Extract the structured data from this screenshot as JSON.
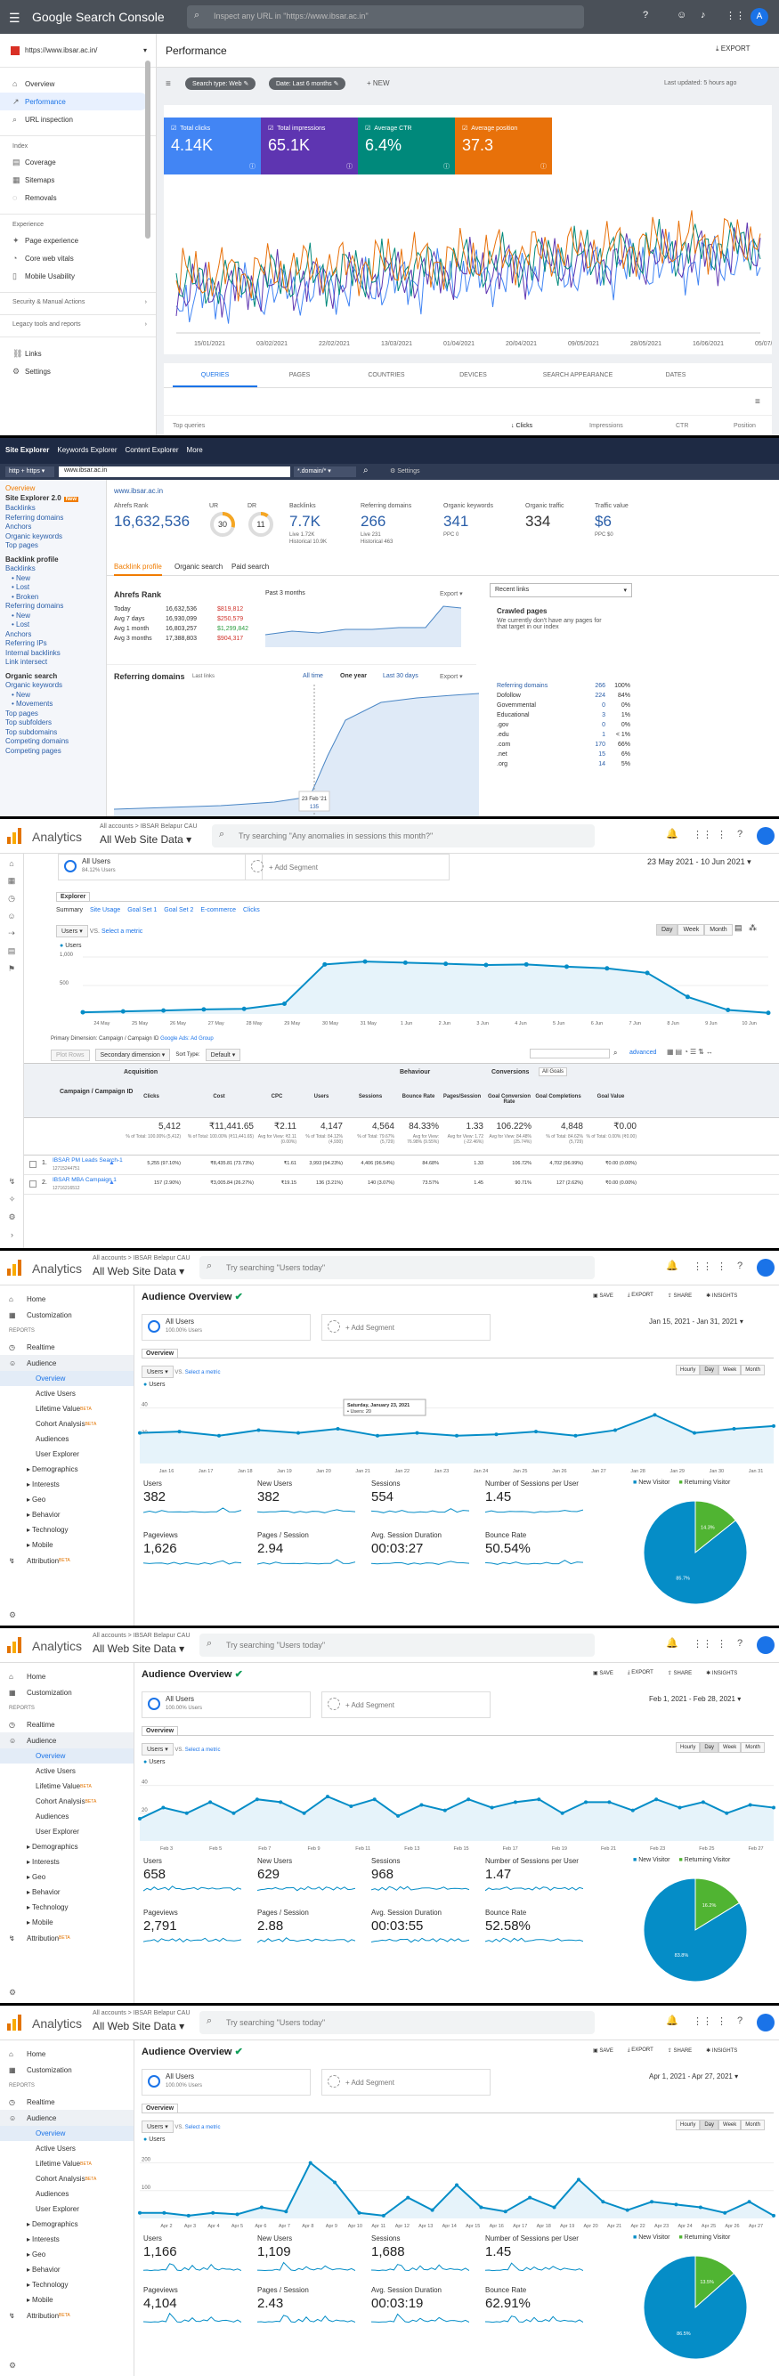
{
  "gsc": {
    "app_title": "Google Search Console",
    "search_placeholder": "Inspect any URL in \"https://www.ibsar.ac.in\"",
    "property": "https://www.ibsar.ac.in/",
    "page_title": "Performance",
    "export_label": "EXPORT",
    "last_updated": "Last updated: 5 hours ago",
    "filter_search_type": "Search type: Web",
    "filter_date": "Date: Last 6 months",
    "new_label": "NEW",
    "nav": [
      {
        "label": "Overview",
        "icon": "home-icon"
      },
      {
        "label": "Performance",
        "icon": "trend-icon",
        "active": true
      },
      {
        "label": "URL inspection",
        "icon": "search-icon"
      }
    ],
    "nav_index_title": "Index",
    "nav_index": [
      "Coverage",
      "Sitemaps",
      "Removals"
    ],
    "nav_experience_title": "Experience",
    "nav_experience": [
      "Page experience",
      "Core web vitals",
      "Mobile Usability"
    ],
    "nav_security": "Security & Manual Actions",
    "nav_legacy": "Legacy tools and reports",
    "nav_links": "Links",
    "nav_settings": "Settings",
    "cards": [
      {
        "label": "Total clicks",
        "value": "4.14K",
        "color": "#4285f4"
      },
      {
        "label": "Total impressions",
        "value": "65.1K",
        "color": "#5e35b1"
      },
      {
        "label": "Average CTR",
        "value": "6.4%",
        "color": "#00897b"
      },
      {
        "label": "Average position",
        "value": "37.3",
        "color": "#e8710a"
      }
    ],
    "x_labels": [
      "15/01/2021",
      "03/02/2021",
      "22/02/2021",
      "13/03/2021",
      "01/04/2021",
      "20/04/2021",
      "09/05/2021",
      "28/05/2021",
      "16/06/2021",
      "05/07/2021"
    ],
    "tabs": [
      "QUERIES",
      "PAGES",
      "COUNTRIES",
      "DEVICES",
      "SEARCH APPEARANCE",
      "DATES"
    ],
    "table_headers": [
      "Top queries",
      "Clicks",
      "Impressions",
      "CTR",
      "Position"
    ]
  },
  "ahrefs": {
    "nav": [
      "Site Explorer",
      "Keywords Explorer",
      "Content Explorer",
      "More"
    ],
    "protocol": "http + https",
    "url": "www.ibsar.ac.in",
    "mode": "*.domain/*",
    "settings": "Settings",
    "sidebar": [
      {
        "t": "Overview",
        "c": "o"
      },
      {
        "t": "Site Explorer 2.0",
        "c": "b",
        "badge": "New"
      },
      {
        "t": "Backlinks"
      },
      {
        "t": "Referring domains"
      },
      {
        "t": "Anchors"
      },
      {
        "t": "Organic keywords"
      },
      {
        "t": "Top pages"
      },
      {
        "t": "Backlink profile",
        "c": "b"
      },
      {
        "t": "Backlinks"
      },
      {
        "t": "New",
        "c": "s"
      },
      {
        "t": "Lost",
        "c": "s"
      },
      {
        "t": "Broken",
        "c": "s"
      },
      {
        "t": "Referring domains"
      },
      {
        "t": "New",
        "c": "s"
      },
      {
        "t": "Lost",
        "c": "s"
      },
      {
        "t": "Anchors"
      },
      {
        "t": "Referring IPs"
      },
      {
        "t": "Internal backlinks"
      },
      {
        "t": "Link intersect"
      },
      {
        "t": "Organic search",
        "c": "b"
      },
      {
        "t": "Organic keywords"
      },
      {
        "t": "New",
        "c": "s"
      },
      {
        "t": "Movements",
        "c": "s"
      },
      {
        "t": "Top pages"
      },
      {
        "t": "Top subfolders"
      },
      {
        "t": "Top subdomains"
      },
      {
        "t": "Competing domains"
      },
      {
        "t": "Competing pages"
      }
    ],
    "site": "www.ibsar.ac.in",
    "ar_label": "Ahrefs Rank",
    "ar_value": "16,632,536",
    "ur_label": "UR",
    "ur_value": "30",
    "dr_label": "DR",
    "dr_value": "11",
    "bl_label": "Backlinks",
    "bl_value": "7.7K",
    "bl_sub1": "Live 1.72K",
    "bl_sub2": "Historical 10.9K",
    "rd_label": "Referring domains",
    "rd_value": "266",
    "rd_sub1": "Live 231",
    "rd_sub2": "Historical 463",
    "ok_label": "Organic keywords",
    "ok_value": "341",
    "ok_sub": "PPC 0",
    "ot_label": "Organic traffic",
    "ot_value": "334",
    "tv_label": "Traffic value",
    "tv_value": "$6",
    "tv_sub": "PPC $0",
    "tabs": [
      "Backlink profile",
      "Organic search",
      "Paid search"
    ],
    "rank_title": "Ahrefs Rank",
    "rank_rows": [
      [
        "Today",
        "16,632,536",
        "$819,812"
      ],
      [
        "Avg 7 days",
        "16,930,099",
        "$250,579"
      ],
      [
        "Avg 1 month",
        "16,803,257",
        "$1,299,842"
      ],
      [
        "Avg 3 months",
        "17,388,803",
        "$904,317"
      ]
    ],
    "past": "Past 3 months",
    "export": "Export",
    "rd_title": "Referring domains",
    "used_links": "Last links",
    "all_time": "All time",
    "one_year": "One year",
    "last30": "Last 30 days",
    "tooltip_date": "23 Feb '21",
    "tooltip_val": "135",
    "recent_links": "Recent links",
    "crawled_title": "Crawled pages",
    "crawled_text": "We currently don't have any pages for that target in our index",
    "rd_table": [
      [
        "Referring domains",
        "266",
        "100%"
      ],
      [
        "Dofollow",
        "224",
        "84%"
      ],
      [
        "Governmental",
        "0",
        "0%"
      ],
      [
        "Educational",
        "3",
        "1%"
      ],
      [
        ".gov",
        "0",
        "0%"
      ],
      [
        ".edu",
        "1",
        "< 1%"
      ],
      [
        ".com",
        "170",
        "66%"
      ],
      [
        ".net",
        "15",
        "6%"
      ],
      [
        ".org",
        "14",
        "5%"
      ]
    ]
  },
  "ga1": {
    "brand": "Analytics",
    "account": "All accounts > IBSAR Belapur CAU",
    "view": "All Web Site Data",
    "search": "Try searching \"Any anomalies in sessions this month?\"",
    "segment": "All Users",
    "segment_pct": "84.12% Users",
    "add_segment": "+ Add Segment",
    "date": "23 May 2021 - 10 Jun 2021",
    "explorer": "Explorer",
    "subtabs": [
      "Summary",
      "Site Usage",
      "Goal Set 1",
      "Goal Set 2",
      "E-commerce",
      "Clicks"
    ],
    "metric": "Users",
    "vs": "VS.",
    "select_metric": "Select a metric",
    "periods": [
      "Day",
      "Week",
      "Month"
    ],
    "legend": "Users",
    "y_labels": [
      "1,000",
      "500"
    ],
    "x_labels": [
      "24 May",
      "25 May",
      "26 May",
      "27 May",
      "28 May",
      "29 May",
      "30 May",
      "31 May",
      "1 Jun",
      "2 Jun",
      "3 Jun",
      "4 Jun",
      "5 Jun",
      "6 Jun",
      "7 Jun",
      "8 Jun",
      "9 Jun",
      "10 Jun"
    ],
    "primary_dim": "Primary Dimension: Campaign / Campaign ID",
    "ads_group": "Google Ads: Ad Group",
    "plot_rows": "Plot Rows",
    "secondary": "Secondary dimension",
    "sort_type": "Sort Type:",
    "default": "Default",
    "advanced": "advanced",
    "conversions": "Conversions",
    "all_goals": "All Goals",
    "col_group1": "Acquisition",
    "col_group2": "Behaviour",
    "col_campaign": "Campaign / Campaign ID",
    "cols": [
      "Clicks",
      "Cost",
      "CPC",
      "Users",
      "Sessions",
      "Bounce Rate",
      "Pages/Session",
      "Goal Conversion Rate",
      "Goal Completions",
      "Goal Value"
    ],
    "totals": [
      "5,412",
      "₹11,441.65",
      "₹2.11",
      "4,147",
      "4,564",
      "84.33%",
      "1.33",
      "106.22%",
      "4,848",
      "₹0.00"
    ],
    "totals_sub": [
      "% of Total: 100.00% (5,412)",
      "% of Total: 100.00% (₹11,441.65)",
      "Avg for View: ₹2.11 (0.00%)",
      "% of Total: 84.12% (4,930)",
      "% of Total: 79.67% (5,729)",
      "Avg for View: 76.98% (9.55%)",
      "Avg for View: 1.72 (-22.46%)",
      "Avg for View: 84.48% (25.74%)",
      "% of Total: 84.62% (5,729)",
      "% of Total: 0.00% (₹0.00)"
    ],
    "rows": [
      {
        "n": "1.",
        "name": "IBSAR PM Leads Search-1",
        "id": "12715244751",
        "vals": [
          "5,255 (97.10%)",
          "₹8,435.81 (73.73%)",
          "₹1.61",
          "3,993 (94.23%)",
          "4,406 (96.54%)",
          "84.68%",
          "1.33",
          "106.72%",
          "4,702 (96.99%)",
          "₹0.00 (0.00%)"
        ]
      },
      {
        "n": "2.",
        "name": "IBSAR MBA Campaign 1",
        "id": "12716216512",
        "vals": [
          "157 (2.90%)",
          "₹3,005.84 (26.27%)",
          "₹19.15",
          "136 (3.21%)",
          "140 (3.07%)",
          "73.57%",
          "1.45",
          "90.71%",
          "127 (2.62%)",
          "₹0.00 (0.00%)"
        ]
      }
    ]
  },
  "overviews": [
    {
      "account": "All accounts > IBSAR Belapur CAU",
      "view": "All Web Site Data",
      "search": "Try searching \"Users today\"",
      "title": "Audience Overview",
      "actions": [
        "SAVE",
        "EXPORT",
        "SHARE",
        "INSIGHTS"
      ],
      "segment": "All Users",
      "segment_pct": "100.00% Users",
      "add_segment": "+ Add Segment",
      "date": "Jan 15, 2021 - Jan 31, 2021",
      "overview_tab": "Overview",
      "metric": "Users",
      "vs": "VS.",
      "select_metric": "Select a metric",
      "periods": [
        "Hourly",
        "Day",
        "Week",
        "Month"
      ],
      "legend": "Users",
      "y_labels": [
        "40",
        "20"
      ],
      "x_labels": [
        "Jan 16",
        "Jan 17",
        "Jan 18",
        "Jan 19",
        "Jan 20",
        "Jan 21",
        "Jan 22",
        "Jan 23",
        "Jan 24",
        "Jan 25",
        "Jan 26",
        "Jan 27",
        "Jan 28",
        "Jan 29",
        "Jan 30",
        "Jan 31"
      ],
      "tooltip_title": "Saturday, January 23, 2021",
      "tooltip_val": "• Users: 20",
      "metrics": [
        [
          "Users",
          "382"
        ],
        [
          "New Users",
          "382"
        ],
        [
          "Sessions",
          "554"
        ],
        [
          "Number of Sessions per User",
          "1.45"
        ],
        [
          "Pageviews",
          "1,626"
        ],
        [
          "Pages / Session",
          "2.94"
        ],
        [
          "Avg. Session Duration",
          "00:03:27"
        ],
        [
          "Bounce Rate",
          "50.54%"
        ]
      ],
      "pie_legend": [
        "New Visitor",
        "Returning Visitor"
      ],
      "pie_new": "85.7%",
      "pie_ret": "14.3%"
    },
    {
      "account": "All accounts > IBSAR Belapur CAU",
      "view": "All Web Site Data",
      "search": "Try searching \"Users today\"",
      "title": "Audience Overview",
      "actions": [
        "SAVE",
        "EXPORT",
        "SHARE",
        "INSIGHTS"
      ],
      "segment": "All Users",
      "segment_pct": "100.00% Users",
      "add_segment": "+ Add Segment",
      "date": "Feb 1, 2021 - Feb 28, 2021",
      "overview_tab": "Overview",
      "metric": "Users",
      "vs": "VS.",
      "select_metric": "Select a metric",
      "periods": [
        "Hourly",
        "Day",
        "Week",
        "Month"
      ],
      "legend": "Users",
      "y_labels": [
        "40",
        "20"
      ],
      "x_labels": [
        "Feb 3",
        "Feb 5",
        "Feb 7",
        "Feb 9",
        "Feb 11",
        "Feb 13",
        "Feb 15",
        "Feb 17",
        "Feb 19",
        "Feb 21",
        "Feb 23",
        "Feb 25",
        "Feb 27"
      ],
      "tooltip_title": "",
      "tooltip_val": "",
      "metrics": [
        [
          "Users",
          "658"
        ],
        [
          "New Users",
          "629"
        ],
        [
          "Sessions",
          "968"
        ],
        [
          "Number of Sessions per User",
          "1.47"
        ],
        [
          "Pageviews",
          "2,791"
        ],
        [
          "Pages / Session",
          "2.88"
        ],
        [
          "Avg. Session Duration",
          "00:03:55"
        ],
        [
          "Bounce Rate",
          "52.58%"
        ]
      ],
      "pie_legend": [
        "New Visitor",
        "Returning Visitor"
      ],
      "pie_new": "83.8%",
      "pie_ret": "16.2%"
    },
    {
      "account": "All accounts > IBSAR Belapur CAU",
      "view": "All Web Site Data",
      "search": "Try searching \"Users today\"",
      "title": "Audience Overview",
      "actions": [
        "SAVE",
        "EXPORT",
        "SHARE",
        "INSIGHTS"
      ],
      "segment": "All Users",
      "segment_pct": "100.00% Users",
      "add_segment": "+ Add Segment",
      "date": "Apr 1, 2021 - Apr 27, 2021",
      "overview_tab": "Overview",
      "metric": "Users",
      "vs": "VS.",
      "select_metric": "Select a metric",
      "periods": [
        "Hourly",
        "Day",
        "Week",
        "Month"
      ],
      "legend": "Users",
      "y_labels": [
        "200",
        "100"
      ],
      "x_labels": [
        "Apr 2",
        "Apr 3",
        "Apr 4",
        "Apr 5",
        "Apr 6",
        "Apr 7",
        "Apr 8",
        "Apr 9",
        "Apr 10",
        "Apr 11",
        "Apr 12",
        "Apr 13",
        "Apr 14",
        "Apr 15",
        "Apr 16",
        "Apr 17",
        "Apr 18",
        "Apr 19",
        "Apr 20",
        "Apr 21",
        "Apr 22",
        "Apr 23",
        "Apr 24",
        "Apr 25",
        "Apr 26",
        "Apr 27"
      ],
      "tooltip_title": "",
      "tooltip_val": "",
      "metrics": [
        [
          "Users",
          "1,166"
        ],
        [
          "New Users",
          "1,109"
        ],
        [
          "Sessions",
          "1,688"
        ],
        [
          "Number of Sessions per User",
          "1.45"
        ],
        [
          "Pageviews",
          "4,104"
        ],
        [
          "Pages / Session",
          "2.43"
        ],
        [
          "Avg. Session Duration",
          "00:03:19"
        ],
        [
          "Bounce Rate",
          "62.91%"
        ]
      ],
      "pie_legend": [
        "New Visitor",
        "Returning Visitor"
      ],
      "pie_new": "86.5%",
      "pie_ret": "13.5%"
    }
  ],
  "ga_nav": {
    "items": [
      "Home",
      "Customization"
    ],
    "reports": "REPORTS",
    "realtime": "Realtime",
    "audience": "Audience",
    "sub": [
      "Overview",
      "Active Users",
      "Lifetime Value",
      "Cohort Analysis",
      "Audiences",
      "User Explorer",
      "Demographics",
      "Interests",
      "Geo",
      "Behavior",
      "Technology",
      "Mobile"
    ],
    "attribution": "Attribution",
    "beta": "BETA"
  },
  "colors": {
    "ga_line": "#058dc7",
    "ga_fill": "#e6f3fa",
    "new_visitor": "#058dc7",
    "returning": "#50b432"
  },
  "chart_data": [
    {
      "type": "line",
      "title": "",
      "series": [
        {
          "name": "Users",
          "values": [
            30,
            45,
            60,
            80,
            90,
            180,
            870,
            920,
            900,
            880,
            860,
            870,
            830,
            800,
            720,
            300,
            70,
            20
          ]
        }
      ],
      "categories": [
        "24 May",
        "25 May",
        "26 May",
        "27 May",
        "28 May",
        "29 May",
        "30 May",
        "31 May",
        "1 Jun",
        "2 Jun",
        "3 Jun",
        "4 Jun",
        "5 Jun",
        "6 Jun",
        "7 Jun",
        "8 Jun",
        "9 Jun",
        "10 Jun"
      ],
      "ylim": [
        0,
        1000
      ]
    },
    {
      "type": "line",
      "series": [
        {
          "name": "Users",
          "values": [
            22,
            23,
            20,
            24,
            22,
            25,
            20,
            22,
            20,
            21,
            23,
            20,
            24,
            35,
            22,
            25,
            27
          ]
        }
      ],
      "categories": [
        "Jan 15",
        "Jan 16",
        "Jan 17",
        "Jan 18",
        "Jan 19",
        "Jan 20",
        "Jan 21",
        "Jan 22",
        "Jan 23",
        "Jan 24",
        "Jan 25",
        "Jan 26",
        "Jan 27",
        "Jan 28",
        "Jan 29",
        "Jan 30",
        "Jan 31"
      ],
      "ylim": [
        0,
        50
      ]
    },
    {
      "type": "line",
      "series": [
        {
          "name": "Users",
          "values": [
            16,
            24,
            20,
            28,
            20,
            30,
            28,
            20,
            32,
            25,
            30,
            18,
            26,
            22,
            30,
            24,
            28,
            30,
            20,
            28,
            28,
            22,
            30,
            24,
            28,
            20,
            26,
            24
          ]
        }
      ],
      "categories": [
        "Feb 1",
        "Feb 2",
        "Feb 3",
        "Feb 4",
        "Feb 5",
        "Feb 6",
        "Feb 7",
        "Feb 8",
        "Feb 9",
        "Feb 10",
        "Feb 11",
        "Feb 12",
        "Feb 13",
        "Feb 14",
        "Feb 15",
        "Feb 16",
        "Feb 17",
        "Feb 18",
        "Feb 19",
        "Feb 20",
        "Feb 21",
        "Feb 22",
        "Feb 23",
        "Feb 24",
        "Feb 25",
        "Feb 26",
        "Feb 27",
        "Feb 28"
      ],
      "ylim": [
        0,
        50
      ]
    },
    {
      "type": "line",
      "series": [
        {
          "name": "Users",
          "values": [
            20,
            20,
            10,
            20,
            15,
            40,
            25,
            200,
            130,
            20,
            10,
            75,
            30,
            120,
            40,
            25,
            75,
            40,
            140,
            60,
            30,
            60,
            50,
            40,
            20,
            60,
            10
          ]
        }
      ],
      "categories": [
        "Apr 1",
        "Apr 2",
        "Apr 3",
        "Apr 4",
        "Apr 5",
        "Apr 6",
        "Apr 7",
        "Apr 8",
        "Apr 9",
        "Apr 10",
        "Apr 11",
        "Apr 12",
        "Apr 13",
        "Apr 14",
        "Apr 15",
        "Apr 16",
        "Apr 17",
        "Apr 18",
        "Apr 19",
        "Apr 20",
        "Apr 21",
        "Apr 22",
        "Apr 23",
        "Apr 24",
        "Apr 25",
        "Apr 26",
        "Apr 27"
      ],
      "ylim": [
        0,
        250
      ]
    }
  ]
}
